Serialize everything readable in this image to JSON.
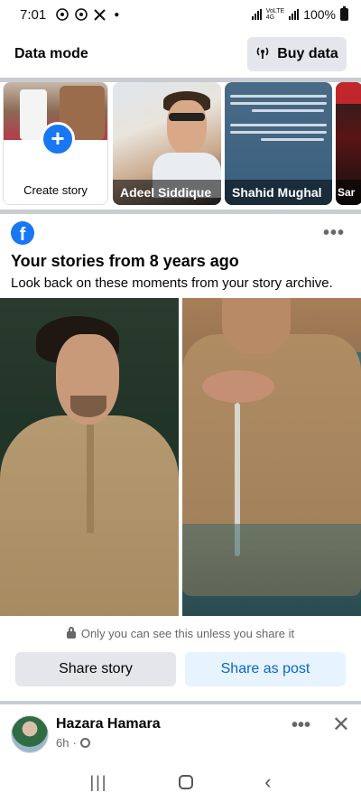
{
  "status_bar": {
    "time": "7:01",
    "notif_icons": [
      "whatsapp-icon",
      "whatsapp-icon",
      "x-icon"
    ],
    "network_label_top": "VoLTE",
    "network_label_4g": "4G",
    "battery": "100%"
  },
  "data_bar": {
    "data_mode_label": "Data mode",
    "buy_data_label": "Buy data"
  },
  "stories": {
    "create_label": "Create story",
    "items": [
      {
        "name": "Adeel Siddique"
      },
      {
        "name": "Shahid Mughal"
      },
      {
        "name": "Sar"
      }
    ]
  },
  "memory": {
    "logo_letter": "f",
    "title": "Your stories from 8 years ago",
    "subtitle": "Look back on these moments from your story archive.",
    "privacy_note": "Only you can see this unless you share it",
    "share_story_label": "Share story",
    "share_post_label": "Share as post"
  },
  "next_post": {
    "author": "Hazara Hamara",
    "time_ago": "6h",
    "more_label": "•••",
    "close_label": "✕"
  },
  "colors": {
    "accent": "#1877f2",
    "secondary_button": "#e4e6eb",
    "primary_light_button": "#e7f3ff"
  }
}
